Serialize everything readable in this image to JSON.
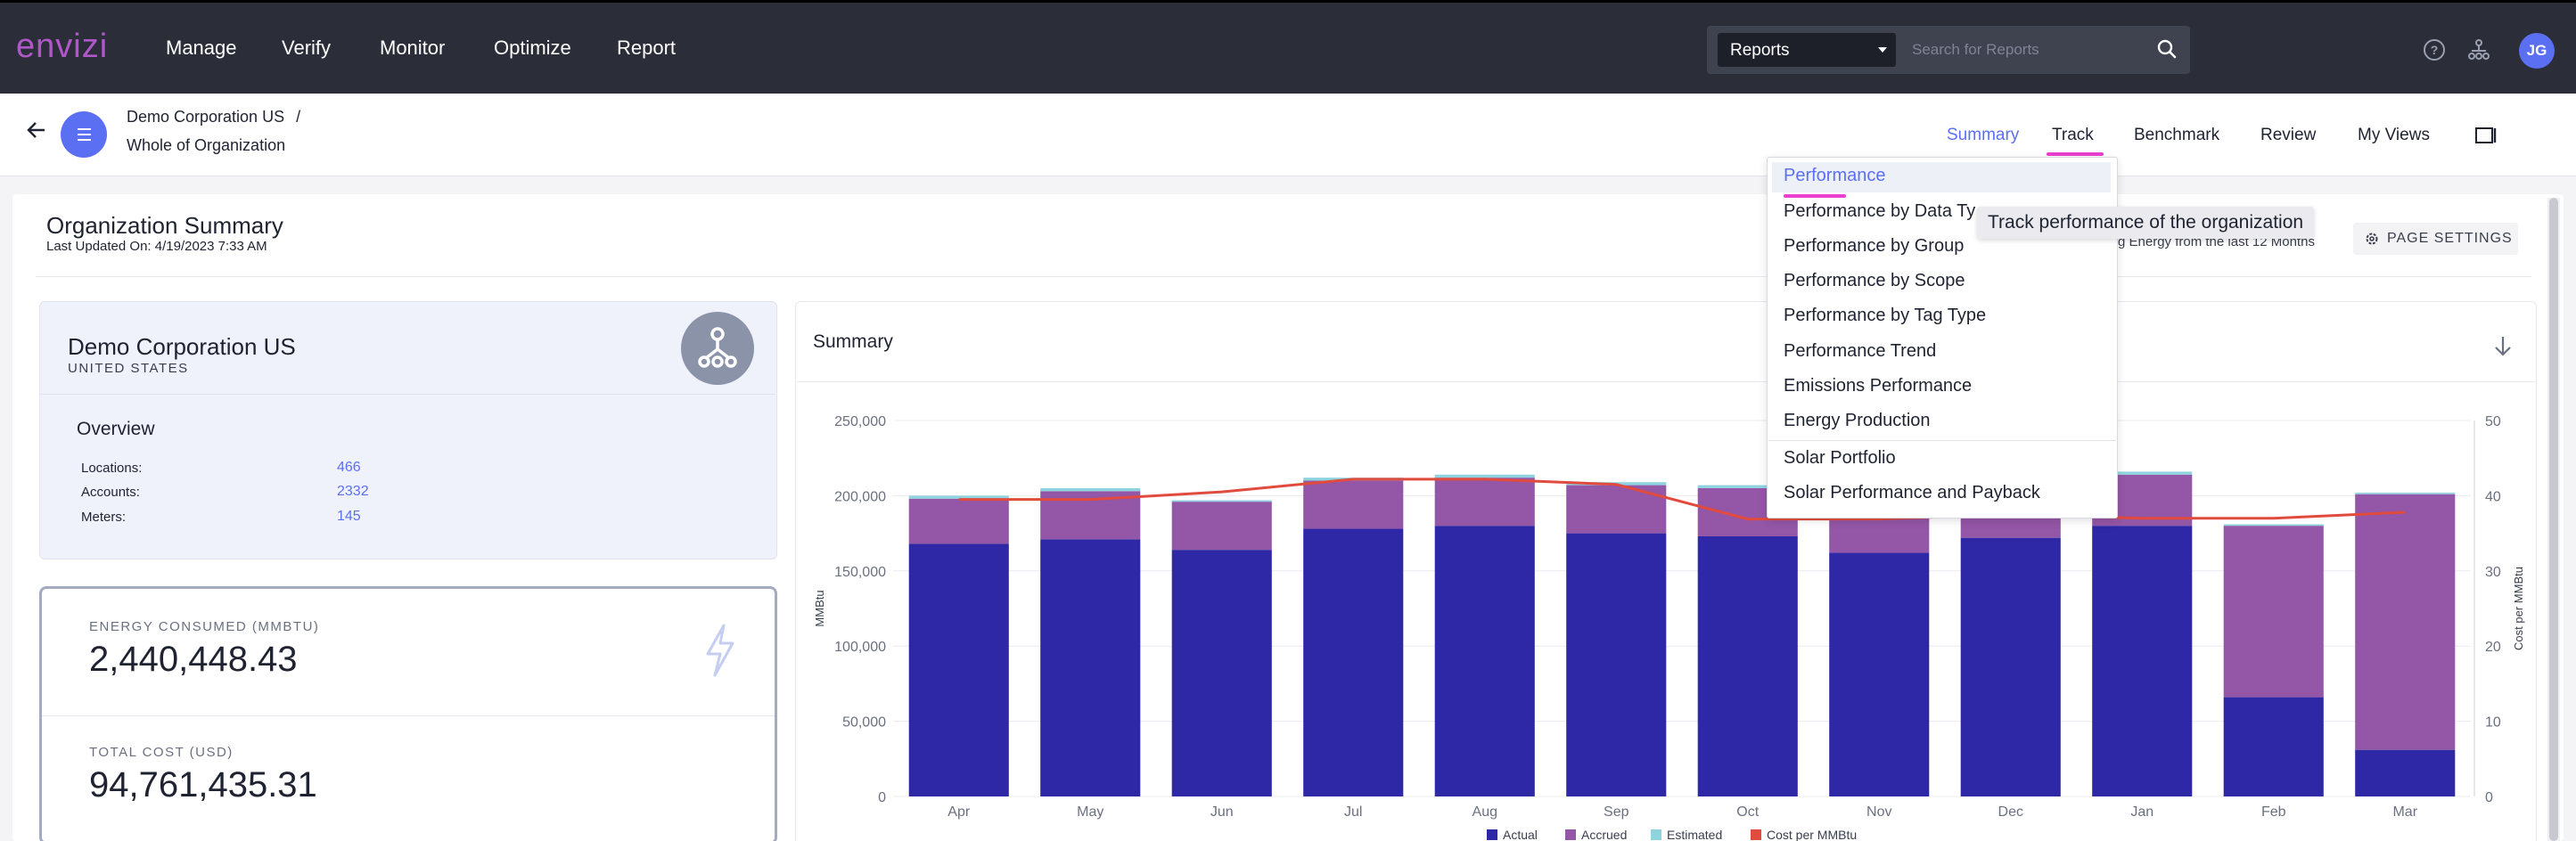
{
  "app": {
    "logo": "envizi",
    "nav": [
      "Manage",
      "Verify",
      "Monitor",
      "Optimize",
      "Report"
    ]
  },
  "search": {
    "category": "Reports",
    "placeholder": "Search for Reports"
  },
  "user": {
    "initials": "JG"
  },
  "breadcrumb": {
    "parent": "Demo Corporation US",
    "separator": "/",
    "current": "Whole of Organization"
  },
  "tabs": [
    "Summary",
    "Track",
    "Benchmark",
    "Review",
    "My Views"
  ],
  "page": {
    "title": "Organization Summary",
    "updated": "Last Updated On: 4/19/2023 7:33 AM",
    "energy_note": "g Energy from the last 12 Months",
    "page_settings": "PAGE SETTINGS"
  },
  "org": {
    "name": "Demo Corporation US",
    "country": "UNITED STATES",
    "overview_title": "Overview",
    "overview": [
      {
        "label": "Locations:",
        "value": "466"
      },
      {
        "label": "Accounts:",
        "value": "2332"
      },
      {
        "label": "Meters:",
        "value": "145"
      }
    ]
  },
  "metrics": [
    {
      "label": "ENERGY CONSUMED (MMBTU)",
      "value": "2,440,448.43"
    },
    {
      "label": "TOTAL COST (USD)",
      "value": "94,761,435.31"
    }
  ],
  "dropdown": {
    "items": [
      "Performance",
      "Performance by Data Ty",
      "Performance by Group",
      "Performance by Scope",
      "Performance by Tag Type",
      "Performance Trend",
      "Emissions Performance",
      "Energy Production",
      "Solar Portfolio",
      "Solar Performance and Payback"
    ],
    "tooltip": "Track performance of the organization"
  },
  "chart": {
    "title": "Summary"
  },
  "chart_data": {
    "type": "bar",
    "categories": [
      "Apr",
      "May",
      "Jun",
      "Jul",
      "Aug",
      "Sep",
      "Oct",
      "Nov",
      "Dec",
      "Jan",
      "Feb",
      "Mar"
    ],
    "series": [
      {
        "name": "Actual",
        "values": [
          168000,
          171000,
          164000,
          178000,
          180000,
          175000,
          173000,
          162000,
          172000,
          180000,
          66000,
          31000
        ],
        "color": "#2e27a6"
      },
      {
        "name": "Accrued",
        "values": [
          30000,
          32000,
          32000,
          32000,
          32000,
          32000,
          32000,
          30000,
          32000,
          34000,
          114000,
          170000
        ],
        "color": "#9456a6"
      },
      {
        "name": "Estimated",
        "values": [
          2000,
          2000,
          1000,
          2000,
          2000,
          2000,
          2000,
          1000,
          2000,
          2000,
          1000,
          1000
        ],
        "color": "#8fd3df"
      }
    ],
    "line": {
      "name": "Cost per MMBtu",
      "values": [
        39.5,
        39.5,
        40.5,
        42.2,
        42.2,
        41.5,
        36.9,
        36.9,
        37.5,
        37.0,
        37.0,
        37.8
      ],
      "color": "#e04b3e"
    },
    "ylabel": "MMBtu",
    "y2label": "Cost per MMBtu",
    "ylim": [
      0,
      250000
    ],
    "y2lim": [
      0,
      50
    ],
    "yticks": [
      "0",
      "50,000",
      "100,000",
      "150,000",
      "200,000",
      "250,000"
    ],
    "y2ticks": [
      "0",
      "10",
      "20",
      "30",
      "40",
      "50"
    ],
    "legend": [
      "Actual",
      "Accrued",
      "Estimated",
      "Cost per MMBtu"
    ]
  }
}
